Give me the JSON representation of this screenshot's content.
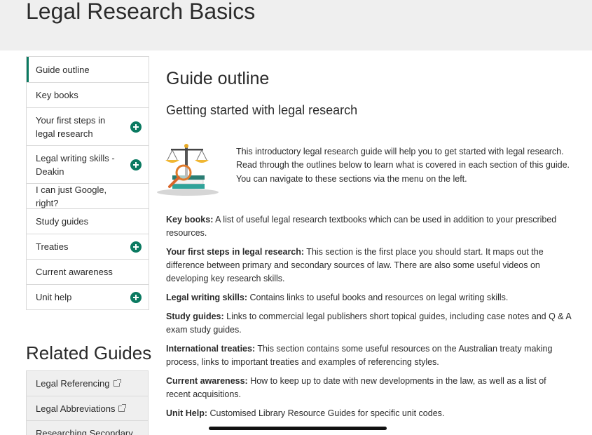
{
  "page_title": "Legal Research Basics",
  "sidebar": {
    "items": [
      {
        "label": "Guide outline",
        "expandable": false,
        "active": true
      },
      {
        "label": "Key books",
        "expandable": false
      },
      {
        "label": "Your first steps in legal research",
        "expandable": true
      },
      {
        "label": "Legal writing skills - Deakin",
        "expandable": true
      },
      {
        "label": "I can just Google, right?",
        "expandable": false
      },
      {
        "label": "Study guides",
        "expandable": false
      },
      {
        "label": "Treaties",
        "expandable": true
      },
      {
        "label": "Current awareness",
        "expandable": false
      },
      {
        "label": "Unit help",
        "expandable": true
      }
    ]
  },
  "related": {
    "title": "Related Guides",
    "items": [
      {
        "label": "Legal Referencing"
      },
      {
        "label": "Legal Abbreviations"
      },
      {
        "label": "Researching Secondary"
      }
    ]
  },
  "main": {
    "heading": "Guide outline",
    "subheading": "Getting started with legal research",
    "intro_icon": "scales-of-justice-icon",
    "intro": "This introductory legal research guide will help you to get started with legal research. Read through the outlines below to learn what is covered in each section of this guide. You can navigate to these sections via the menu on the left.",
    "sections": [
      {
        "term": "Key books:",
        "desc": " A list of useful legal research textbooks which can be used in addition to your prescribed resources."
      },
      {
        "term": "Your first steps in legal research:",
        "desc": " This section is the first place you should start. It maps out the difference between primary and secondary sources of law. There are also some useful videos on developing key research skills."
      },
      {
        "term": "Legal writing skills:",
        "desc": " Contains links to useful books and resources on legal writing skills."
      },
      {
        "term": "Study guides:",
        "desc": " Links to commercial legal publishers short topical guides, including case notes and Q & A exam study guides."
      },
      {
        "term": "International treaties:",
        "desc": " This section contains some useful resources on the Australian treaty making process, links to important treaties and examples of referencing styles."
      },
      {
        "term": "Current awareness:",
        "desc": " How to keep up to date with new developments in the law, as well as a list of recent acquisitions."
      },
      {
        "term": "Unit Help:",
        "desc": " Customised Library Resource Guides for specific unit codes."
      }
    ]
  },
  "colors": {
    "accent": "#0b7a61",
    "banner_bg": "#efefef",
    "border": "#d9d9d9"
  }
}
